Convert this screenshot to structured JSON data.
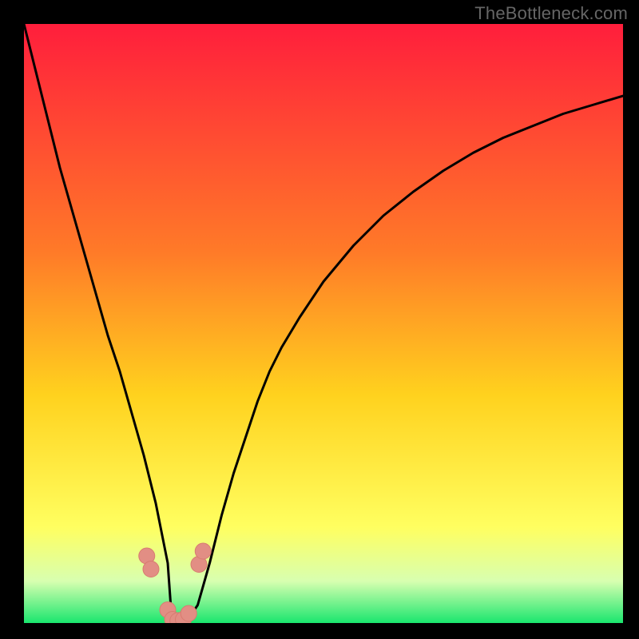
{
  "watermark": "TheBottleneck.com",
  "colors": {
    "black": "#000000",
    "curve": "#000000",
    "marker_fill": "#e28e84",
    "marker_stroke": "#d87b70",
    "gradient": {
      "top": "#ff1e3c",
      "mid1": "#ff7a28",
      "mid2": "#ffd21e",
      "mid3": "#ffff60",
      "mid4": "#d8ffb0",
      "bottom": "#1ae66e"
    }
  },
  "chart_data": {
    "type": "line",
    "title": "",
    "xlabel": "",
    "ylabel": "",
    "xlim": [
      0,
      100
    ],
    "ylim": [
      0,
      100
    ],
    "grid": false,
    "legend": false,
    "annotations": [],
    "series": [
      {
        "name": "curve",
        "x": [
          0,
          2,
          4,
          6,
          8,
          10,
          12,
          14,
          16,
          18,
          20,
          22,
          24,
          24.5,
          25.5,
          27,
          29,
          31,
          33,
          35,
          37,
          39,
          41,
          43,
          46,
          50,
          55,
          60,
          65,
          70,
          75,
          80,
          85,
          90,
          95,
          100
        ],
        "y": [
          100,
          92,
          84,
          76,
          69,
          62,
          55,
          48,
          42,
          35,
          28,
          20,
          10,
          3,
          0,
          0,
          3,
          10,
          18,
          25,
          31,
          37,
          42,
          46,
          51,
          57,
          63,
          68,
          72,
          75.5,
          78.5,
          81,
          83,
          85,
          86.5,
          88
        ]
      }
    ],
    "markers": [
      {
        "x": 20.5,
        "y": 11.2
      },
      {
        "x": 21.2,
        "y": 9.0
      },
      {
        "x": 24.0,
        "y": 2.2
      },
      {
        "x": 24.8,
        "y": 0.6
      },
      {
        "x": 25.7,
        "y": 0.4
      },
      {
        "x": 26.6,
        "y": 0.6
      },
      {
        "x": 27.5,
        "y": 1.6
      },
      {
        "x": 29.2,
        "y": 9.8
      },
      {
        "x": 29.9,
        "y": 12.0
      }
    ]
  }
}
